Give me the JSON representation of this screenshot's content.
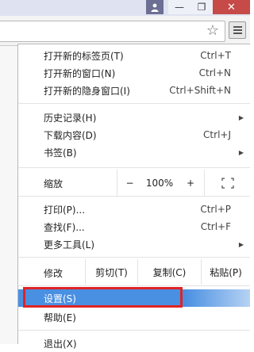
{
  "titlebar": {
    "min_glyph": "—",
    "max_glyph": "❐",
    "close_glyph": "✕"
  },
  "menu": {
    "items": [
      {
        "label": "打开新的标签页(T)",
        "shortcut": "Ctrl+T"
      },
      {
        "label": "打开新的窗口(N)",
        "shortcut": "Ctrl+N"
      },
      {
        "label": "打开新的隐身窗口(I)",
        "shortcut": "Ctrl+Shift+N"
      },
      {
        "label": "历史记录(H)",
        "shortcut": ""
      },
      {
        "label": "下载内容(D)",
        "shortcut": "Ctrl+J"
      },
      {
        "label": "书签(B)",
        "shortcut": ""
      },
      {
        "label": "打印(P)...",
        "shortcut": "Ctrl+P"
      },
      {
        "label": "查找(F)...",
        "shortcut": "Ctrl+F"
      },
      {
        "label": "更多工具(L)",
        "shortcut": ""
      },
      {
        "label": "设置(S)",
        "shortcut": ""
      },
      {
        "label": "帮助(E)",
        "shortcut": ""
      },
      {
        "label": "退出(X)",
        "shortcut": ""
      }
    ],
    "zoom": {
      "label": "缩放",
      "minus": "−",
      "value": "100%",
      "plus": "+",
      "fullscreen_glyph": "⛶"
    },
    "edit": {
      "label": "修改",
      "cut": "剪切(T)",
      "copy": "复制(C)",
      "paste": "粘贴(P)"
    },
    "submenu_arrow": "▶"
  },
  "colors": {
    "highlight": "#4a90e2",
    "annotation_border": "#e02424",
    "close_button": "#c64a48"
  }
}
